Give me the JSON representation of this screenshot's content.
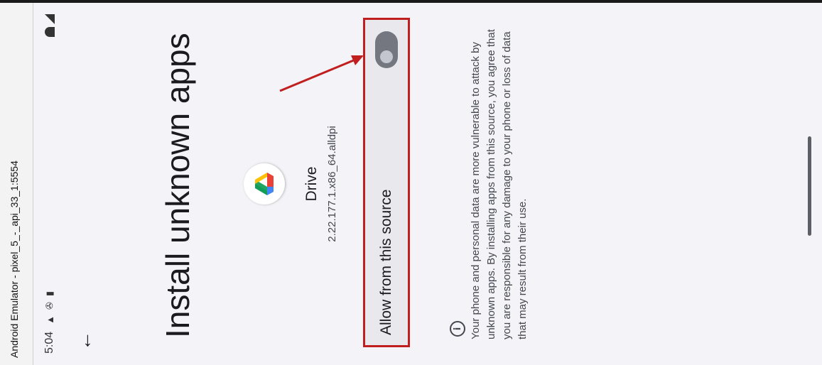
{
  "window": {
    "title": "Android Emulator - pixel_5_-_api_33_1:5554"
  },
  "status_bar": {
    "time": "5:04"
  },
  "page": {
    "title": "Install unknown apps"
  },
  "app": {
    "name": "Drive",
    "version": "2.22.177.1.x86_64.alldpi",
    "icon": "google-drive-logo"
  },
  "setting": {
    "label": "Allow from this source",
    "enabled": false
  },
  "warning": {
    "text": "Your phone and personal data are more vulnerable to attack by unknown apps. By installing apps from this source, you agree that you are responsible for any damage to your phone or loss of data that may result from their use."
  },
  "icons": {
    "back": "arrow-back-icon",
    "info": "info-icon"
  },
  "colors": {
    "highlight": "#c11f1f",
    "switch_off_track": "#74777f"
  }
}
